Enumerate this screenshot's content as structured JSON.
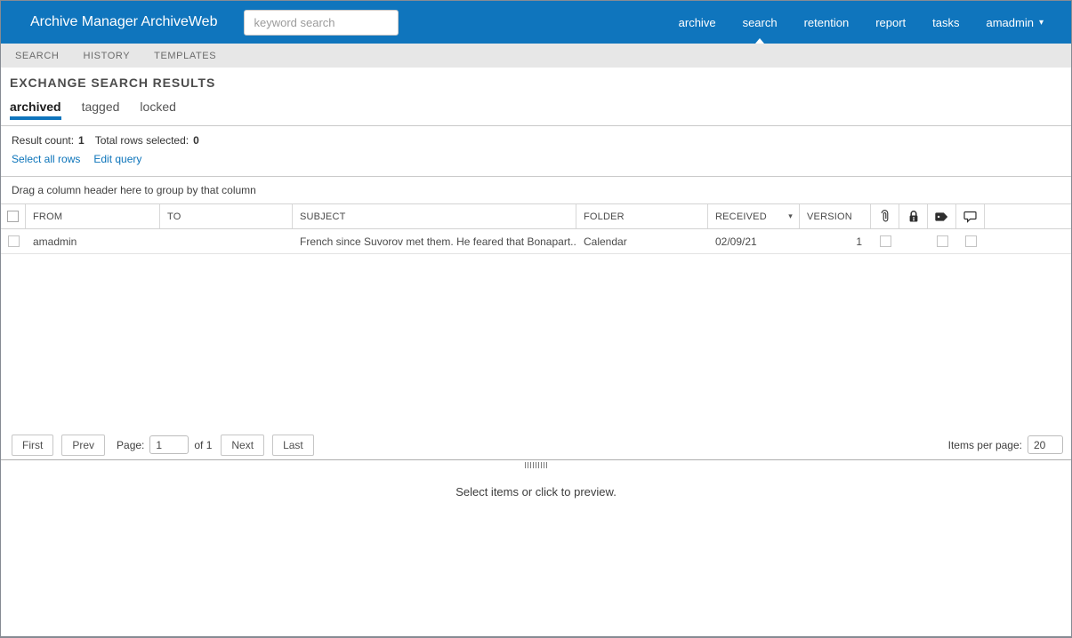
{
  "colors": {
    "header_blue": "#0f75bd",
    "link_blue": "#0c74ba",
    "tab_underline_blue": "#0f75bd"
  },
  "topbar": {
    "brand": "Archive Manager ArchiveWeb",
    "search_placeholder": "keyword search",
    "nav": [
      {
        "label": "archive",
        "active": false
      },
      {
        "label": "search",
        "active": true
      },
      {
        "label": "retention",
        "active": false
      },
      {
        "label": "report",
        "active": false
      },
      {
        "label": "tasks",
        "active": false
      }
    ],
    "user_menu": {
      "label": "amadmin"
    }
  },
  "subnav": {
    "items": [
      {
        "label": "SEARCH"
      },
      {
        "label": "HISTORY"
      },
      {
        "label": "TEMPLATES"
      }
    ]
  },
  "main": {
    "title": "EXCHANGE SEARCH RESULTS",
    "tabs": [
      {
        "label": "archived",
        "active": true
      },
      {
        "label": "tagged",
        "active": false
      },
      {
        "label": "locked",
        "active": false
      }
    ]
  },
  "summary": {
    "result_count_label": "Result count:",
    "result_count": "1",
    "total_selected_label": "Total rows selected:",
    "total_selected": "0",
    "select_all_link": "Select all rows",
    "edit_query_link": "Edit query"
  },
  "grid": {
    "group_hint": "Drag a column header here to group by that column",
    "columns": {
      "from": "FROM",
      "to": "TO",
      "subject": "SUBJECT",
      "folder": "FOLDER",
      "received": "RECEIVED",
      "version": "VERSION"
    },
    "icon_columns": [
      "attachment-icon",
      "lock-icon",
      "tag-icon",
      "comment-icon"
    ],
    "rows": [
      {
        "from": "amadmin",
        "to": "",
        "subject": "French since Suvorov met them. He feared that Bonapart...",
        "folder": "Calendar",
        "received": "02/09/21",
        "version": "1",
        "attachment_checkbox": true,
        "lock_checkbox": false,
        "tag_checkbox": true,
        "comment_checkbox": true
      }
    ]
  },
  "pager": {
    "first": "First",
    "prev": "Prev",
    "page_label": "Page:",
    "page_value": "1",
    "of_label": "of 1",
    "next": "Next",
    "last": "Last",
    "items_per_page_label": "Items per page:",
    "items_per_page_value": "20"
  },
  "preview": {
    "placeholder": "Select items or click to preview."
  }
}
